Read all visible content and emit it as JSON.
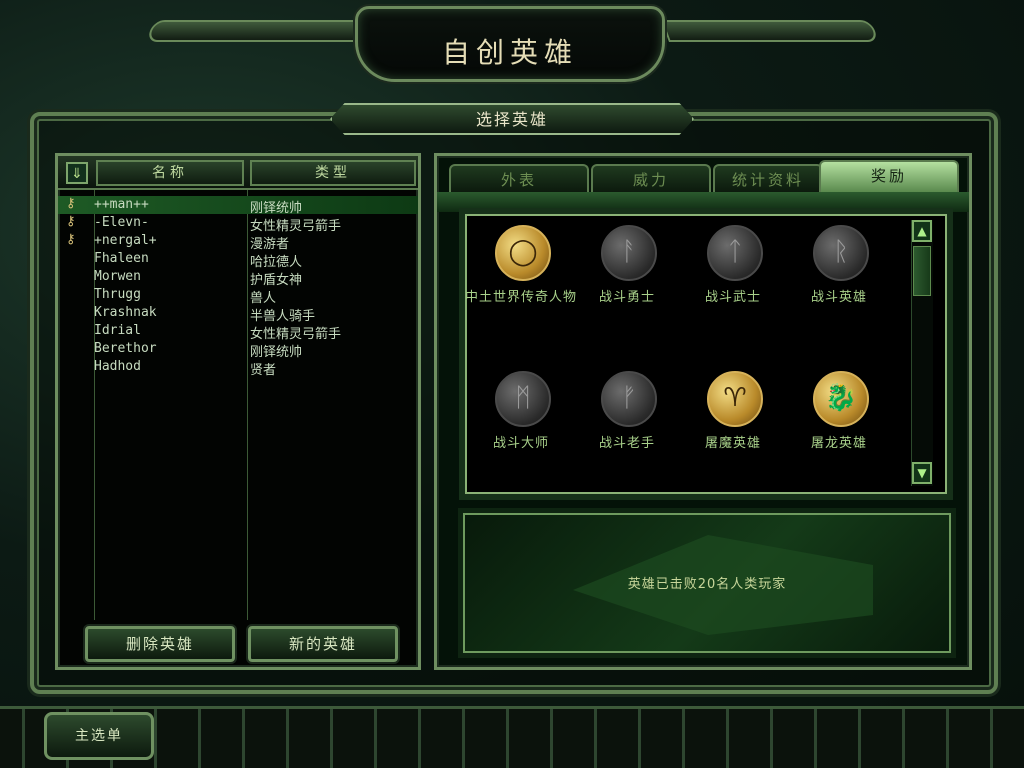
{
  "window": {
    "title": "自创英雄",
    "subtitle": "选择英雄"
  },
  "hero_list": {
    "sort_icon": "⇓",
    "columns": [
      "名称",
      "类型"
    ],
    "rows": [
      {
        "name": "++man++",
        "type": "刚铎统帅",
        "has_key": true
      },
      {
        "name": "-Elevn-",
        "type": "女性精灵弓箭手",
        "has_key": true
      },
      {
        "name": "+nergal+",
        "type": "漫游者",
        "has_key": true
      },
      {
        "name": "Fhaleen",
        "type": "哈拉德人",
        "has_key": false
      },
      {
        "name": "Morwen",
        "type": "护盾女神",
        "has_key": false
      },
      {
        "name": "Thrugg",
        "type": "兽人",
        "has_key": false
      },
      {
        "name": "Krashnak",
        "type": "半兽人骑手",
        "has_key": false
      },
      {
        "name": "Idrial",
        "type": "女性精灵弓箭手",
        "has_key": false
      },
      {
        "name": "Berethor",
        "type": "刚铎统帅",
        "has_key": false
      },
      {
        "name": "Hadhod",
        "type": "贤者",
        "has_key": false
      }
    ],
    "selected_index": 0
  },
  "buttons": {
    "delete": "删除英雄",
    "new": "新的英雄",
    "main_menu": "主选单"
  },
  "tabs": [
    "外表",
    "威力",
    "统计资料",
    "奖励"
  ],
  "active_tab": "奖励",
  "rewards": [
    {
      "label": "中土世界传奇人物",
      "icon": "ring-icon",
      "glyph": "◯",
      "earned": true
    },
    {
      "label": "战斗勇士",
      "icon": "rune-icon",
      "glyph": "ᚨ",
      "earned": false
    },
    {
      "label": "战斗武士",
      "icon": "rune-icon",
      "glyph": "ᛏ",
      "earned": false
    },
    {
      "label": "战斗英雄",
      "icon": "rune-icon",
      "glyph": "ᚱ",
      "earned": false
    },
    {
      "label": "战斗大师",
      "icon": "rune-icon",
      "glyph": "ᛗ",
      "earned": false
    },
    {
      "label": "战斗老手",
      "icon": "rune-icon",
      "glyph": "ᚠ",
      "earned": false
    },
    {
      "label": "屠魔英雄",
      "icon": "balrog-icon",
      "glyph": "♈",
      "earned": true
    },
    {
      "label": "屠龙英雄",
      "icon": "dragon-icon",
      "glyph": "🐉",
      "earned": true
    }
  ],
  "reward_description": "英雄已击败20名人类玩家",
  "colors": {
    "frame": "#6e8e60",
    "accent": "#1e5a25",
    "gold": "#d6b25a"
  }
}
